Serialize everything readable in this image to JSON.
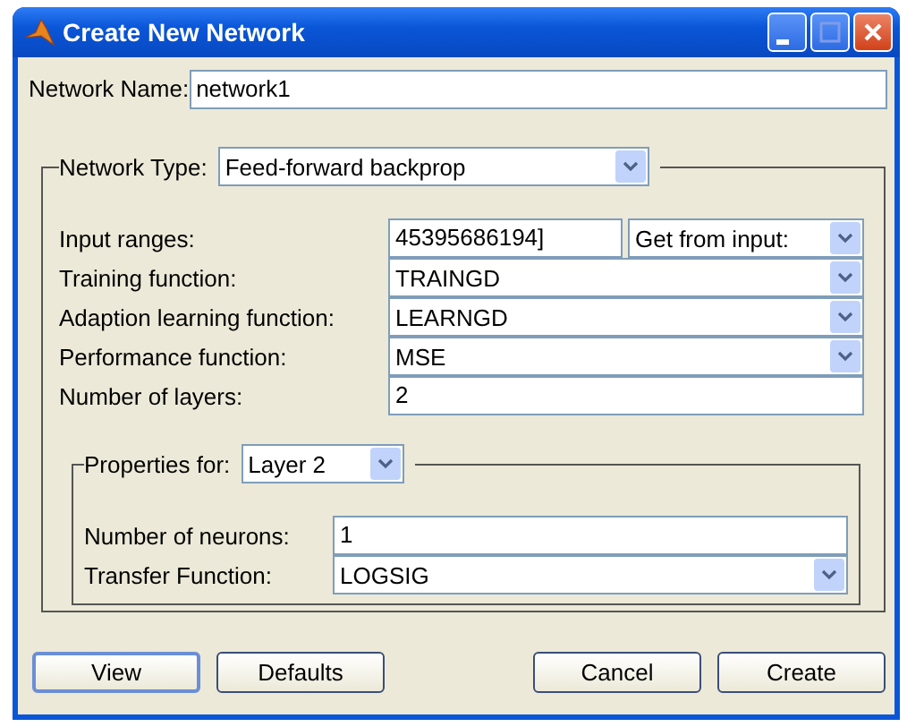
{
  "window": {
    "title": "Create New Network"
  },
  "network_name": {
    "label": "Network Name:",
    "value": "network1"
  },
  "network_type": {
    "label": "Network Type:",
    "value": "Feed-forward backprop"
  },
  "parameters": [
    {
      "kind": "range",
      "label": "Input ranges:",
      "value": "45395686194]",
      "source": "Get from input:"
    },
    {
      "kind": "combo",
      "label": "Training function:",
      "value": "TRAINGD"
    },
    {
      "kind": "combo",
      "label": "Adaption learning function:",
      "value": "LEARNGD"
    },
    {
      "kind": "combo",
      "label": "Performance function:",
      "value": "MSE"
    },
    {
      "kind": "field",
      "label": "Number of layers:",
      "value": "2"
    }
  ],
  "properties": {
    "label": "Properties for:",
    "layer": "Layer 2",
    "fields": [
      {
        "kind": "field",
        "label": "Number of neurons:",
        "value": "1"
      },
      {
        "kind": "combo",
        "label": "Transfer Function:",
        "value": "LOGSIG"
      }
    ]
  },
  "left_buttons": [
    {
      "label": "View",
      "focused": true
    },
    {
      "label": "Defaults",
      "focused": false
    }
  ],
  "right_buttons": [
    {
      "label": "Cancel",
      "focused": false
    },
    {
      "label": "Create",
      "focused": false
    }
  ]
}
